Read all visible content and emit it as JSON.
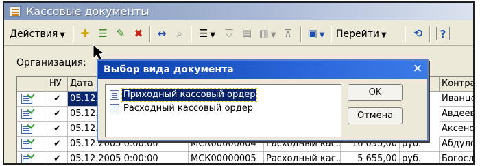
{
  "window": {
    "title": "Кассовые документы"
  },
  "toolbar": {
    "actions_label": "Действия",
    "goto_label": "Перейти",
    "help_label": "?",
    "icons": [
      "add-icon",
      "add-copy-icon",
      "edit-icon",
      "delete-icon",
      "move-icon",
      "search-icon",
      "list-view-icon",
      "filter-icon",
      "filter-set-icon",
      "filter-history-icon",
      "filter-clear-icon",
      "post-icon",
      "refresh-icon"
    ]
  },
  "filter": {
    "organization_label": "Организация:"
  },
  "grid": {
    "columns": [
      "НУ",
      "Дата",
      "",
      "",
      "",
      "Контраг"
    ],
    "rows": [
      {
        "nu": "✔",
        "date": "05.12.",
        "number": "",
        "kind": "",
        "amount": "",
        "contractor": "Иванцо"
      },
      {
        "nu": "✔",
        "date": "05.12.",
        "number": "",
        "kind": "",
        "amount": "",
        "contractor": "Авдеев"
      },
      {
        "nu": "✔",
        "date": "05.12.",
        "number": "",
        "kind": "",
        "amount": "",
        "contractor": "Аксено"
      },
      {
        "nu": "✔",
        "date": "05.12.2005 0:00:00",
        "number": "МСК00000004",
        "kind": "Расходный кас...",
        "amount": "16 095,00",
        "currency": "руб.",
        "contractor": "Абдуло"
      },
      {
        "nu": "✔",
        "date": "05.12.2005 0:00:00",
        "number": "МСК00000005",
        "kind": "Расходный кас...",
        "amount": "5 655,00",
        "currency": "руб.",
        "contractor": "Богосл"
      }
    ],
    "partial_header_fragment": "та"
  },
  "dialog": {
    "title": "Выбор вида документа",
    "items": [
      {
        "label": "Приходный кассовый ордер",
        "selected": true
      },
      {
        "label": "Расходный кассовый ордер",
        "selected": false
      }
    ],
    "ok_label": "OK",
    "cancel_label": "Отмена"
  },
  "colors": {
    "dialog_titlebar": "#0b3ea8",
    "selection": "#0a246a",
    "window_title_gradient_start": "#7f94b8"
  }
}
